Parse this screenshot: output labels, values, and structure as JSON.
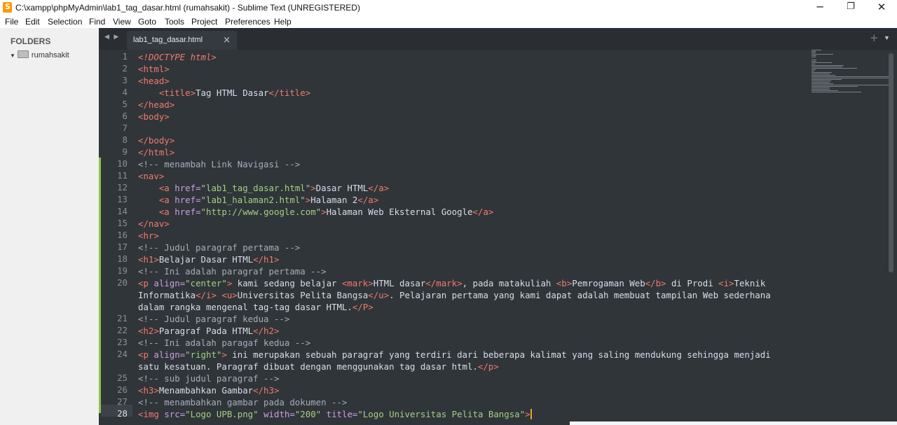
{
  "window": {
    "title": "C:\\xampp\\phpMyAdmin\\lab1_tag_dasar.html (rumahsakit) - Sublime Text (UNREGISTERED)",
    "controls": {
      "minimize": "─",
      "restore": "❐",
      "close": "✕"
    }
  },
  "menu": [
    "File",
    "Edit",
    "Selection",
    "Find",
    "View",
    "Goto",
    "Tools",
    "Project",
    "Preferences",
    "Help"
  ],
  "sidebar": {
    "header": "FOLDERS",
    "folder": "rumahsakit",
    "expander": "▼"
  },
  "tabs": {
    "arrows": "◀ ▶",
    "active_label": "lab1_tag_dasar.html",
    "close_glyph": "×",
    "new_tab_glyph": "+",
    "dropdown_glyph": "▼"
  },
  "editor": {
    "current_line": 28,
    "line_numbers": [
      "1",
      "2",
      "3",
      "4",
      "5",
      "6",
      "7",
      "8",
      "9",
      "10",
      "11",
      "12",
      "13",
      "14",
      "15",
      "16",
      "17",
      "18",
      "19",
      "20",
      "",
      "",
      "21",
      "22",
      "23",
      "24",
      "",
      "25",
      "26",
      "27",
      "28"
    ],
    "lines": [
      [
        [
          "dt",
          "<!DOCTYPE html>"
        ]
      ],
      [
        [
          "tag",
          "<html>"
        ]
      ],
      [
        [
          "tag",
          "<head>"
        ]
      ],
      [
        [
          "txt",
          "    "
        ],
        [
          "tag",
          "<title>"
        ],
        [
          "txt",
          "Tag HTML Dasar"
        ],
        [
          "tag",
          "</title>"
        ]
      ],
      [
        [
          "tag",
          "</head>"
        ]
      ],
      [
        [
          "tag",
          "<body>"
        ]
      ],
      [],
      [
        [
          "tag",
          "</body>"
        ]
      ],
      [
        [
          "tag",
          "</html>"
        ]
      ],
      [
        [
          "cmt",
          "<!-- menambah Link Navigasi -->"
        ]
      ],
      [
        [
          "tag",
          "<nav>"
        ]
      ],
      [
        [
          "txt",
          "    "
        ],
        [
          "tag",
          "<a "
        ],
        [
          "attr",
          "href="
        ],
        [
          "str",
          "\"lab1_tag_dasar.html\""
        ],
        [
          "tag",
          ">"
        ],
        [
          "txt",
          "Dasar HTML"
        ],
        [
          "tag",
          "</a>"
        ]
      ],
      [
        [
          "txt",
          "    "
        ],
        [
          "tag",
          "<a "
        ],
        [
          "attr",
          "href="
        ],
        [
          "str",
          "\"lab1_halaman2.html\""
        ],
        [
          "tag",
          ">"
        ],
        [
          "txt",
          "Halaman 2"
        ],
        [
          "tag",
          "</a>"
        ]
      ],
      [
        [
          "txt",
          "    "
        ],
        [
          "tag",
          "<a "
        ],
        [
          "attr",
          "href="
        ],
        [
          "str",
          "\"http://www.google.com\""
        ],
        [
          "tag",
          ">"
        ],
        [
          "txt",
          "Halaman Web Eksternal Google"
        ],
        [
          "tag",
          "</a>"
        ]
      ],
      [
        [
          "tag",
          "</nav>"
        ]
      ],
      [
        [
          "tag",
          "<hr>"
        ]
      ],
      [
        [
          "cmt",
          "<!-- Judul paragraf pertama -->"
        ]
      ],
      [
        [
          "tag",
          "<h1>"
        ],
        [
          "txt",
          "Belajar Dasar HTML"
        ],
        [
          "tag",
          "</h1>"
        ]
      ],
      [
        [
          "cmt",
          "<!-- Ini adalah paragraf pertama -->"
        ]
      ],
      [
        [
          "tag",
          "<p "
        ],
        [
          "attr",
          "align="
        ],
        [
          "str",
          "\"center\""
        ],
        [
          "tag",
          ">"
        ],
        [
          "txt",
          " kami sedang belajar "
        ],
        [
          "tag",
          "<mark>"
        ],
        [
          "txt",
          "HTML dasar"
        ],
        [
          "tag",
          "</mark>"
        ],
        [
          "txt",
          ", pada matakuliah "
        ],
        [
          "tag",
          "<b>"
        ],
        [
          "txt",
          "Pemrogaman Web"
        ],
        [
          "tag",
          "</b>"
        ],
        [
          "txt",
          " di Prodi "
        ],
        [
          "tag",
          "<i>"
        ],
        [
          "txt",
          "Teknik"
        ]
      ],
      [
        [
          "txt",
          "Informatika"
        ],
        [
          "tag",
          "</i>"
        ],
        [
          "txt",
          " "
        ],
        [
          "tag",
          "<u>"
        ],
        [
          "txt",
          "Universitas Pelita Bangsa"
        ],
        [
          "tag",
          "</u>"
        ],
        [
          "txt",
          ". Pelajaran pertama yang kami dapat adalah membuat tampilan Web sederhana"
        ]
      ],
      [
        [
          "txt",
          "dalam rangka mengenal tag-tag dasar HTML."
        ],
        [
          "tag",
          "</P>"
        ]
      ],
      [
        [
          "cmt",
          "<!-- Judul paragraf kedua -->"
        ]
      ],
      [
        [
          "tag",
          "<h2>"
        ],
        [
          "txt",
          "Paragraf Pada HTML"
        ],
        [
          "tag",
          "</h2>"
        ]
      ],
      [
        [
          "cmt",
          "<!-- Ini adalah paragaf kedua -->"
        ]
      ],
      [
        [
          "tag",
          "<p "
        ],
        [
          "attr",
          "align="
        ],
        [
          "str",
          "\"right\""
        ],
        [
          "tag",
          ">"
        ],
        [
          "txt",
          " ini merupakan sebuah paragraf yang terdiri dari beberapa kalimat yang saling mendukung sehingga menjadi"
        ]
      ],
      [
        [
          "txt",
          "satu kesatuan. Paragraf dibuat dengan menggunakan tag dasar html."
        ],
        [
          "tag",
          "</p>"
        ]
      ],
      [
        [
          "cmt",
          "<!-- sub judul paragraf -->"
        ]
      ],
      [
        [
          "tag",
          "<h3>"
        ],
        [
          "txt",
          "Menambahkan Gambar"
        ],
        [
          "tag",
          "</h3>"
        ]
      ],
      [
        [
          "cmt",
          "<!-- menambahkan gambar pada dokumen -->"
        ]
      ],
      [
        [
          "tag",
          "<img "
        ],
        [
          "attr",
          "src="
        ],
        [
          "str",
          "\"Logo UPB.png\""
        ],
        [
          "txt",
          " "
        ],
        [
          "attr",
          "width="
        ],
        [
          "str",
          "\"200\""
        ],
        [
          "txt",
          " "
        ],
        [
          "attr",
          "title="
        ],
        [
          "str",
          "\"Logo Universitas Pelita Bangsa\""
        ],
        [
          "tag",
          ">"
        ]
      ]
    ]
  },
  "colors": {
    "editor_bg": "#30353a",
    "tag": "#f27a6c",
    "attribute": "#c9a0e0",
    "string": "#a3d080",
    "comment": "#a7adba",
    "text": "#d8dee9",
    "caret": "#f0a020",
    "modified_marker": "#8cc44a"
  }
}
